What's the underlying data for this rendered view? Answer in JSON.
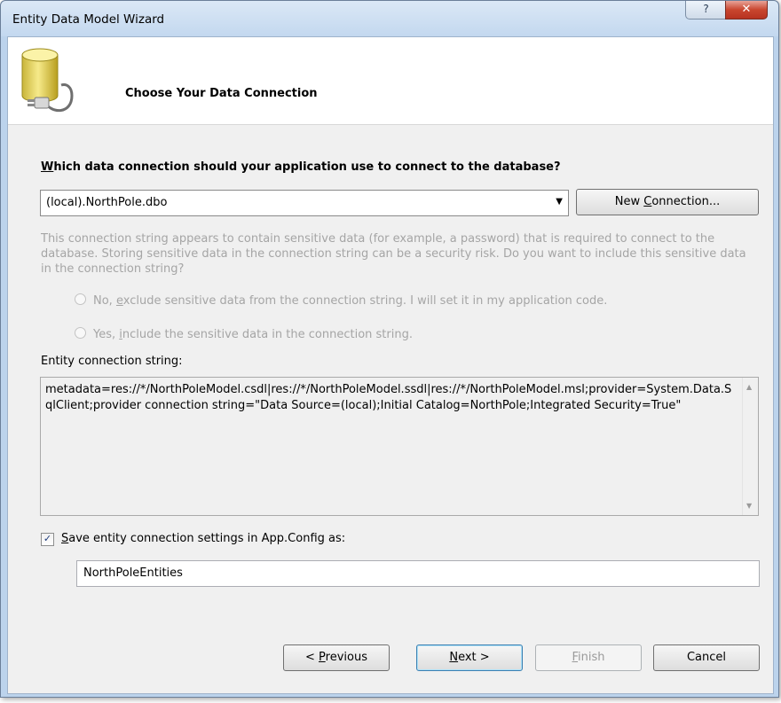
{
  "window": {
    "title": "Entity Data Model Wizard",
    "help_glyph": "?",
    "close_glyph": "✕"
  },
  "header": {
    "title": "Choose Your Data Connection",
    "icon": "database-plug-icon"
  },
  "connection": {
    "question_prefix": "W",
    "question_rest": "hich data connection should your application use to connect to the database?",
    "selected": "(local).NorthPole.dbo",
    "new_connection_label_a": "New ",
    "new_connection_label_u": "C",
    "new_connection_label_b": "onnection..."
  },
  "sensitive": {
    "info": "This connection string appears to contain sensitive data (for example, a password) that is required to connect to the database. Storing sensitive data in the connection string can be a security risk. Do you want to include this sensitive data in the connection string?",
    "option_no_a": "No, ",
    "option_no_u": "e",
    "option_no_b": "xclude sensitive data from the connection string. I will set it in my application code.",
    "option_yes_a": "Yes, ",
    "option_yes_u": "i",
    "option_yes_b": "nclude the sensitive data in the connection string."
  },
  "entity": {
    "label": "Entity connection string:",
    "value": "metadata=res://*/NorthPoleModel.csdl|res://*/NorthPoleModel.ssdl|res://*/NorthPoleModel.msl;provider=System.Data.SqlClient;provider connection string=\"Data Source=(local);Initial Catalog=NorthPole;Integrated Security=True\""
  },
  "save": {
    "checked": true,
    "check_glyph": "✓",
    "label_u": "S",
    "label_rest": "ave entity connection settings in App.Config as:",
    "name_value": "NorthPoleEntities"
  },
  "buttons": {
    "previous_a": "< ",
    "previous_u": "P",
    "previous_b": "revious",
    "next_u": "N",
    "next_b": "ext >",
    "finish_u": "F",
    "finish_b": "inish",
    "cancel": "Cancel"
  }
}
